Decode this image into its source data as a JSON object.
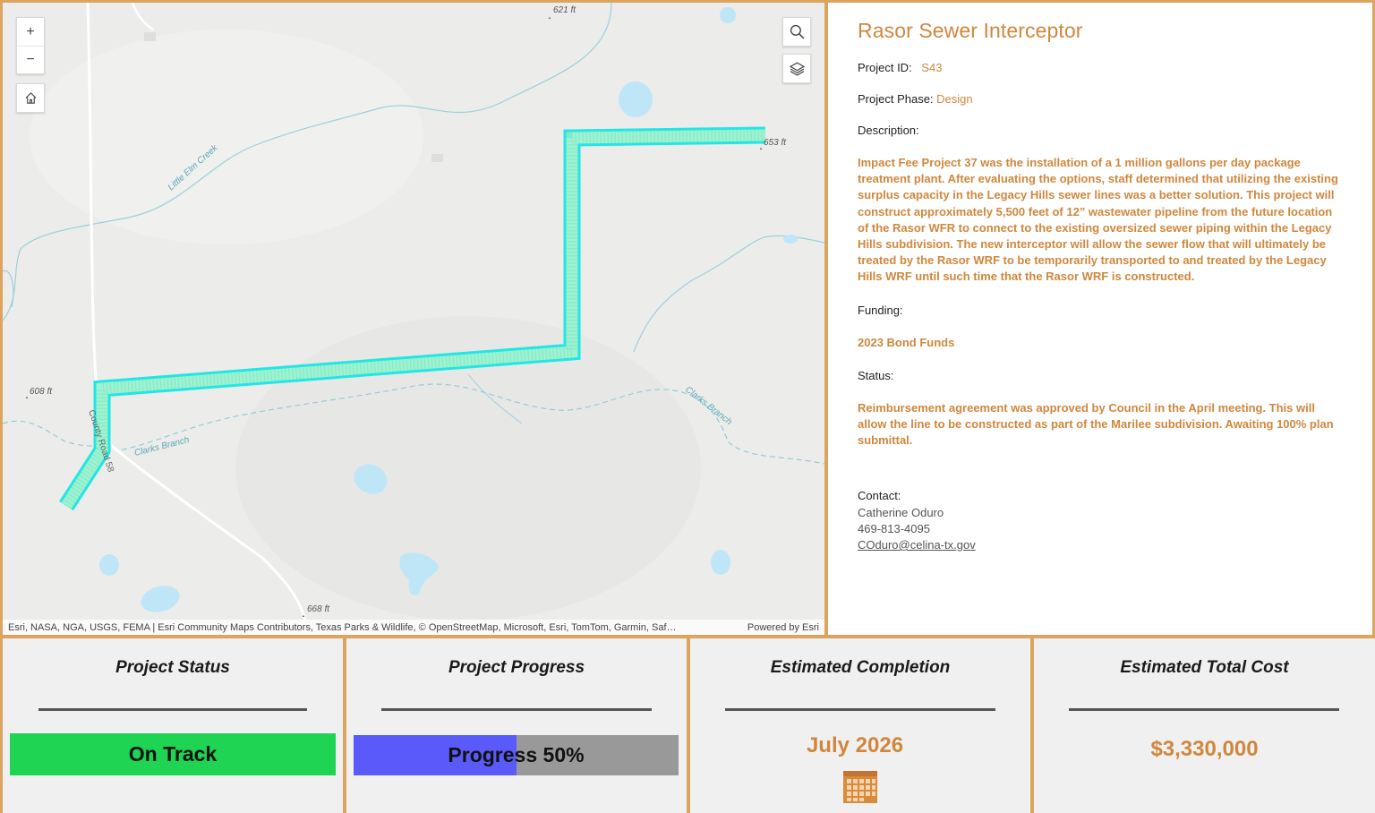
{
  "map": {
    "labels": {
      "elev_621": "621 ft",
      "elev_653": "653 ft",
      "elev_608": "608 ft",
      "elev_668": "668 ft",
      "creek_little_elm": "Little Elm Creek",
      "clarks_branch_1": "Clarks Branch",
      "clarks_branch_2": "Clarks Branch",
      "county_road": "County Road 58"
    },
    "controls": {
      "zoom_in": "+",
      "zoom_out": "−"
    },
    "attribution": "Esri, NASA, NGA, USGS, FEMA | Esri Community Maps Contributors, Texas Parks & Wildlife, © OpenStreetMap, Microsoft, Esri, TomTom, Garmin, Saf…",
    "powered_by": "Powered by Esri",
    "colors": {
      "pipeline_outline": "#22e6e6",
      "pipeline_fill": "#9ef2cf",
      "water": "#bfe6f7",
      "stream": "#8ec9d6"
    }
  },
  "info": {
    "title": "Rasor Sewer Interceptor",
    "project_id_label": "Project ID:",
    "project_id": "S43",
    "phase_label": "Project Phase:",
    "phase": "Design",
    "description_label": "Description:",
    "description": "Impact Fee Project 37 was the installation of a 1 million gallons per day package treatment plant. After evaluating the options, staff determined that utilizing the existing surplus capacity in the Legacy Hills sewer lines was a better solution. This project will construct approximately 5,500 feet of 12” wastewater pipeline from the future location of the Rasor WFR to connect to the existing oversized sewer piping within the Legacy Hills subdivision. The new interceptor will allow the sewer flow that will ultimately be treated by the Rasor WRF to be temporarily transported to and treated by the Legacy Hills WRF until such time that the Rasor WRF is constructed.",
    "funding_label": "Funding:",
    "funding": "2023 Bond Funds",
    "status_label": "Status:",
    "status": "Reimbursement agreement was approved by Council in the April meeting. This will allow the line to be constructed as part of the Marilee subdivision. Awaiting 100% plan submittal.",
    "contact_label": "Contact:",
    "contact_name": "Catherine Oduro",
    "contact_phone": "469-813-4095",
    "contact_email": "COduro@celina-tx.gov",
    "accent_color": "#d0873d"
  },
  "cards": {
    "status": {
      "title": "Project Status",
      "value": "On Track",
      "color": "#1ed452"
    },
    "progress": {
      "title": "Project Progress",
      "label": "Progress 50%",
      "percent": 50,
      "fill_color": "#5a5afa"
    },
    "completion": {
      "title": "Estimated Completion",
      "value": "July 2026",
      "icon": "calendar-icon"
    },
    "cost": {
      "title": "Estimated Total Cost",
      "value": "$3,330,000"
    }
  }
}
